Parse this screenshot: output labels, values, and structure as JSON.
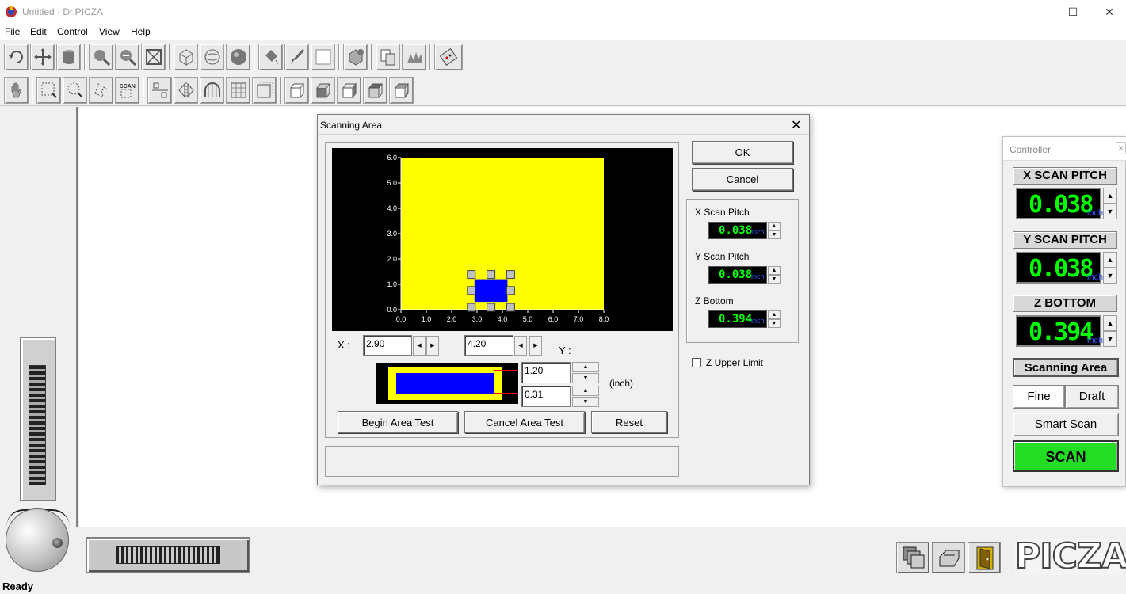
{
  "window": {
    "title": "Untitled - Dr.PICZA",
    "minimize": "—",
    "maximize": "☐",
    "close": "✕"
  },
  "menu": [
    "File",
    "Edit",
    "Control",
    "View",
    "Help"
  ],
  "status": "Ready",
  "dialog": {
    "title": "Scanning Area",
    "close": "✕",
    "ok": "OK",
    "cancel": "Cancel",
    "x_label": "X :",
    "y_label": "Y :",
    "x_start": "2.90",
    "x_end": "4.20",
    "y_end": "1.20",
    "y_start": "0.31",
    "unit": "(inch)",
    "begin_test": "Begin Area Test",
    "cancel_test": "Cancel Area Test",
    "reset": "Reset",
    "x_pitch_label": "X Scan Pitch",
    "x_pitch": "0.038",
    "y_pitch_label": "Y Scan Pitch",
    "y_pitch": "0.038",
    "z_bottom_label": "Z Bottom",
    "z_bottom": "0.394",
    "lcd_unit": "inch",
    "z_upper_label": "Z Upper Limit",
    "z_upper_checked": false
  },
  "chart_data": {
    "type": "scatter",
    "x_ticks": [
      "0.0",
      "1.0",
      "2.0",
      "3.0",
      "4.0",
      "5.0",
      "6.0",
      "7.0",
      "8.0"
    ],
    "y_ticks": [
      "0.0",
      "1.0",
      "2.0",
      "3.0",
      "4.0",
      "5.0",
      "6.0"
    ],
    "xlim": [
      0,
      8
    ],
    "ylim": [
      0,
      6
    ],
    "scan_area": {
      "x0": 2.9,
      "x1": 4.2,
      "y0": 0.31,
      "y1": 1.2
    },
    "colors": {
      "background": "#000000",
      "bed": "#ffff00",
      "area": "#0000ff"
    }
  },
  "controller": {
    "title": "Controller",
    "close": "×",
    "x_pitch_header": "X SCAN PITCH",
    "x_pitch": "0.038",
    "y_pitch_header": "Y SCAN PITCH",
    "y_pitch": "0.038",
    "z_bottom_header": "Z BOTTOM",
    "z_bottom": "0.394",
    "unit": "inch",
    "scanning_area": "Scanning Area",
    "fine": "Fine",
    "draft": "Draft",
    "smart_scan": "Smart Scan",
    "scan": "SCAN",
    "scan_color": "#22dd22"
  },
  "logo": "PICZA"
}
